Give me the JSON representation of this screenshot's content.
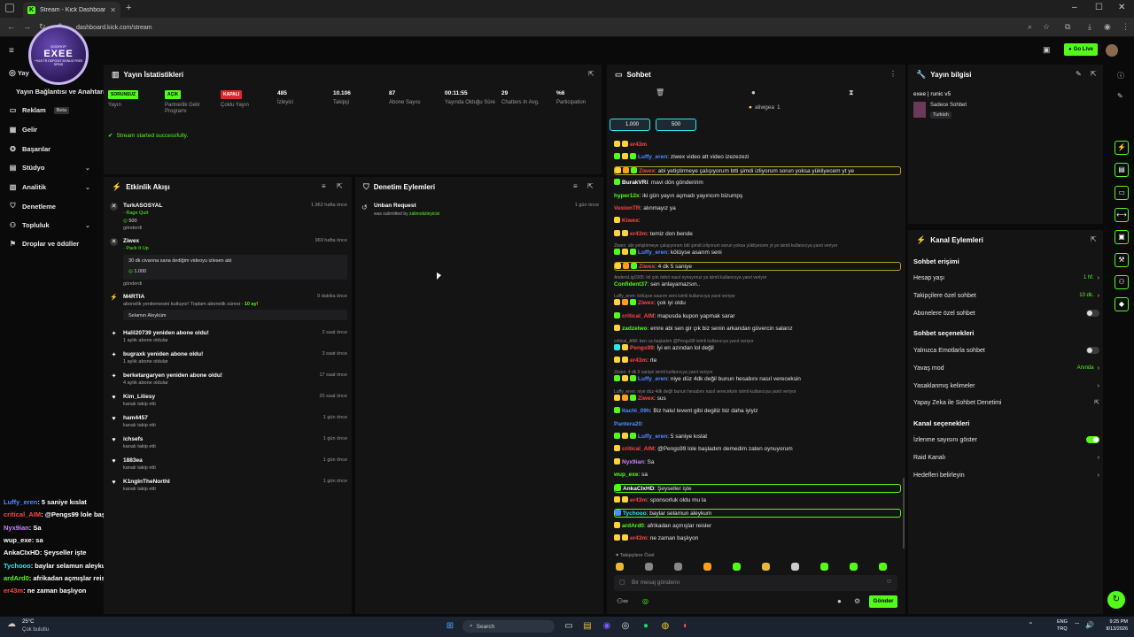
{
  "browser": {
    "tab_title": "Stream - Kick Dashboard",
    "url": "dashboard.kick.com/stream"
  },
  "header": {
    "go_live": "Go Live"
  },
  "overlay": {
    "brand": "GODROP",
    "name": "EXEE",
    "tagline": "+%15 TR DEPOSIT BONUS FREE SPINS"
  },
  "nav": {
    "items": [
      {
        "label": "Yayın Bağlantısı ve Anahtarı"
      },
      {
        "label": "Reklam",
        "badge": "Beta"
      },
      {
        "label": "Gelir"
      },
      {
        "label": "Başarılar"
      },
      {
        "label": "Stüdyo"
      },
      {
        "label": "Analitik"
      },
      {
        "label": "Denetleme"
      },
      {
        "label": "Topluluk"
      },
      {
        "label": "Droplar ve ödüller"
      }
    ],
    "partial": "Yay"
  },
  "stream_overlay_chat": [
    {
      "user": "Luffy_eren",
      "text": ": 5 saniye kıslat",
      "color": "#4f8cff"
    },
    {
      "user": "critical_AIM",
      "text": ": @Pengs99 lole başladım demedim zaten oynuyorum",
      "color": "#ff4545"
    },
    {
      "user": "Nyx9ian",
      "text": ": Sa",
      "color": "#c882ff"
    },
    {
      "user": "wup_exe",
      "text": ": sa",
      "color": "#fff"
    },
    {
      "user": "AnkaCIxHD",
      "text": ": Şeyseller işte",
      "color": "#fff"
    },
    {
      "user": "Tychooo",
      "text": ": baylar selamun aleykum",
      "color": "#2ee6e6"
    },
    {
      "user": "ardArd0",
      "text": ": afrikadan açmışlar reisler",
      "color": "#53fc18"
    },
    {
      "user": "er43m",
      "text": ": ne zaman başlıyon",
      "color": "#ff4545"
    }
  ],
  "stats": {
    "title": "Yayın İstatistikleri",
    "items": [
      {
        "value": "SORUNSUZ",
        "label": "Yayın",
        "chip": "#53fc18"
      },
      {
        "value": "AÇIK",
        "label": "Partnerlik Gelir Programı",
        "chip": "#53fc18"
      },
      {
        "value": "KAPALI",
        "label": "Çoklu Yayın",
        "chip": "#e0262b"
      },
      {
        "value": "485",
        "label": "İzleyici"
      },
      {
        "value": "10.106",
        "label": "Takipçi"
      },
      {
        "value": "87",
        "label": "Abone Sayısı"
      },
      {
        "value": "00:11:55",
        "label": "Yayında Olduğu Süre"
      },
      {
        "value": "29",
        "label": "Chatters In Avg."
      },
      {
        "value": "%6",
        "label": "Participation"
      }
    ],
    "success": "Stream started successfully."
  },
  "activity": {
    "title": "Etkinlik Akışı",
    "items": [
      {
        "name": "TurkASOSYAL",
        "sub": "Rage Quit",
        "extra": "500",
        "extra2": "gönderdi",
        "time": "1.962 hafta önce"
      },
      {
        "name": "Ziwex",
        "sub": "Pack It Up",
        "message": "30 dk civarına sana dediğim videoyu izlesen abi",
        "extra": "1.000",
        "extra2": "gönderdi",
        "time": "969 hafta önce"
      },
      {
        "name": "M4RTIA",
        "sub": "abonelik yenilemesini kutluyor! Toplam abonelik süresi - ",
        "sub_bold": "10 ay!",
        "message": "Selamın Aleyküm",
        "time": "9 dakika önce"
      },
      {
        "name": "Halil20739 yeniden abone oldu!",
        "sub": "1 aylık abone oldular",
        "time": "2 saat önce"
      },
      {
        "name": "bugraxk yeniden abone oldu!",
        "sub": "1 aylık abone oldular",
        "time": "3 saat önce"
      },
      {
        "name": "berketargaryen yeniden abone oldu!",
        "sub": "4 aylık abone oldular",
        "time": "17 saat önce"
      },
      {
        "name": "Kim_Liliesy",
        "sub": "kanalı takip etti",
        "time": "20 saat önce"
      },
      {
        "name": "ham4457",
        "sub": "kanalı takip etti",
        "time": "1 gün önce"
      },
      {
        "name": "ichsefs",
        "sub": "kanalı takip etti",
        "time": "1 gün önce"
      },
      {
        "name": "1883ea",
        "sub": "kanalı takip etti",
        "time": "1 gün önce"
      },
      {
        "name": "K1ngInTheNorthI",
        "sub": "kanalı takip etti",
        "time": "1 gün önce"
      }
    ]
  },
  "moderation": {
    "title": "Denetim Eylemleri",
    "items": [
      {
        "name": "Unban Request",
        "sub": "was submitted by ",
        "sub_user": "zalimotizleyicisi",
        "time": "1 gün önce"
      }
    ]
  },
  "chat": {
    "title": "Sohbet",
    "pinned_user": "aliwgea",
    "pinned_count": "1",
    "goal1": "1.000",
    "goal2": "500",
    "messages": [
      {
        "user": "er43m",
        "text": "",
        "color": "#ff4545",
        "badges": [
          "#ffd23a",
          "#ffd23a"
        ]
      },
      {
        "user": "Luffy_eren",
        "text": ": ziwex video att video izezezezi",
        "color": "#4f8cff",
        "badges": [
          "#53fc18",
          "#ffd23a",
          "#53fc18"
        ]
      },
      {
        "user": "Ziwex",
        "text": ": abi yetiştirmeye çalışıyorum btti şimdi izliyorum sorun yoksa yükliyecem yt ye",
        "color": "#ff4545",
        "badges": [
          "#ffd23a",
          "#ff9f1a",
          "#53fc18"
        ],
        "hl": true
      },
      {
        "user": "BurakVRi",
        "text": ": mavi dön gönderirim",
        "color": "#fff",
        "badges": [
          "#53fc18"
        ]
      },
      {
        "user": "hyper12x",
        "text": ": iki gün yayın açmadı yayıncım bizumpş",
        "color": "#53fc18",
        "badges": []
      },
      {
        "user": "VexionTR",
        "text": ": alınmayız ya",
        "color": "#ff4545",
        "badges": []
      },
      {
        "user": "Kiwex",
        "text": ":",
        "color": "#ff4545",
        "badges": [
          "#ffd23a"
        ]
      },
      {
        "user": "er43m",
        "text": ": temiz don bende",
        "color": "#ff4545",
        "badges": [
          "#ffd23a",
          "#ffd23a"
        ]
      },
      {
        "small": "Ziwex: abi yetiştirmeye çalışıyorum btti şimdi izliyorum sorun yoksa yükliyecem yt ye isimli kullanıcıya yanıt veriyor"
      },
      {
        "user": "Luffy_eren",
        "text": ": kötüyse asarım seni",
        "color": "#4f8cff",
        "badges": [
          "#53fc18",
          "#ffd23a",
          "#53fc18"
        ]
      },
      {
        "user": "Ziwex",
        "text": ": 4 dk 5 saniye",
        "color": "#ff4545",
        "badges": [
          "#ffd23a",
          "#ff9f1a",
          "#53fc18"
        ],
        "hl": true
      },
      {
        "small": "AndersLig1905: lol çok ödnö nasıl oynuyoruz ya isimli kullanıcıya yanıt veriyor"
      },
      {
        "user": "Confident37",
        "text": ": sen anlayamazsın..",
        "color": "#53fc18",
        "badges": []
      },
      {
        "small": "Luffy_eren: kötüyse asarım seni isimli kullanıcıya yanıt veriyor"
      },
      {
        "user": "Ziwex",
        "text": ": çok iyi oldu",
        "color": "#ff4545",
        "badges": [
          "#ffd23a",
          "#ff9f1a",
          "#53fc18"
        ]
      },
      {
        "user": "critical_AIM",
        "text": ": mapusda kupon yapmak sarar",
        "color": "#ff4545",
        "badges": [
          "#53fc18"
        ]
      },
      {
        "user": "zadzelwo",
        "text": ": emre abi sen gir çık biz senin arkandan güvercin salarız",
        "color": "#53fc18",
        "badges": [
          "#ffd23a"
        ]
      },
      {
        "small": "critical_AIM: ben ca başladım @Pengs99 isimli kullanıcıya yanıt veriyor"
      },
      {
        "user": "Pengs99",
        "text": ": İyi en azından lol değil",
        "color": "#ff4545",
        "badges": [
          "#2ee6e6",
          "#ffd23a"
        ]
      },
      {
        "user": "er43m",
        "text": ": rte",
        "color": "#ff4545",
        "badges": [
          "#ffd23a",
          "#ffd23a"
        ]
      },
      {
        "small": "Ziwex: 4 dk 5 saniye isimli kullanıcıya yanıt veriyor"
      },
      {
        "user": "Luffy_eren",
        "text": ": niye düz 4dk değil bunun hesabını nasıl vereceksin",
        "color": "#4f8cff",
        "badges": [
          "#53fc18",
          "#ffd23a",
          "#53fc18"
        ]
      },
      {
        "small": "Luffy_eren: niye düz 4dk değil bunun hesabını nasıl vereceksin isimli kullanıcıya yanıt veriyor"
      },
      {
        "user": "Ziwex",
        "text": ": sus",
        "color": "#ff4545",
        "badges": [
          "#ffd23a",
          "#ff9f1a",
          "#53fc18"
        ]
      },
      {
        "user": "Itachi_09h",
        "text": ": Biz halul levent gibi degiliz biz daha iyiyiz",
        "color": "#4f8cff",
        "badges": [
          "#53fc18"
        ]
      },
      {
        "user": "Pantera20",
        "text": ":",
        "color": "#4f8cff",
        "badges": []
      },
      {
        "user": "Luffy_eren",
        "text": ": 5 saniye kıslat",
        "color": "#4f8cff",
        "badges": [
          "#53fc18",
          "#ffd23a",
          "#53fc18"
        ]
      },
      {
        "user": "critical_AIM",
        "text": ": @Pengs99 lole başladım demedim zaten oynuyorum",
        "color": "#ff4545",
        "badges": [
          "#ffd23a"
        ]
      },
      {
        "user": "Nyx9ian",
        "text": ": Sa",
        "color": "#c882ff",
        "badges": [
          "#ffd23a"
        ]
      },
      {
        "user": "wup_exe",
        "text": ": sa",
        "color": "#53fc18",
        "badges": []
      },
      {
        "user": "AnkaCIxHD",
        "text": ": Şeyseller işte",
        "color": "#fff",
        "badges": [
          "#53fc18"
        ],
        "hlg": true
      },
      {
        "user": "er43m",
        "text": ": sponsorluk oldu mu la",
        "color": "#ff4545",
        "badges": [
          "#ffd23a",
          "#ffd23a"
        ]
      },
      {
        "user": "Tychooo",
        "text": ": baylar selamun aleykum",
        "color": "#2ee6e6",
        "badges": [
          "#4f8cff"
        ],
        "hlg": true
      },
      {
        "user": "ardArd0",
        "text": ": afrikadan açmışlar reisler",
        "color": "#53fc18",
        "badges": [
          "#ffd23a"
        ]
      },
      {
        "user": "er43m",
        "text": ": ne zaman başlıyon",
        "color": "#ff4545",
        "badges": [
          "#ffd23a",
          "#ffd23a"
        ]
      }
    ],
    "mode_label": "Takipçilere Özel",
    "input_placeholder": "Bir mesaj gönderin",
    "send": "Gönder"
  },
  "stream_info": {
    "title": "Yayın bilgisi",
    "stream_title": "exee | runic v5",
    "chat_mode": "Sadece Sohbet",
    "language": "Turkish"
  },
  "channel_actions": {
    "title": "Kanal Eylemleri",
    "chat_access": "Sohbet erişimi",
    "rows1": [
      {
        "label": "Hesap yaşı",
        "value": "1 hf."
      },
      {
        "label": "Takipçilere özel sohbet",
        "value": "10 dk."
      },
      {
        "label": "Abonelere özel sohbet",
        "toggle": false
      }
    ],
    "chat_options": "Sohbet seçenekleri",
    "rows2": [
      {
        "label": "Yalnızca Emotlarla sohbet",
        "toggle": false
      },
      {
        "label": "Yavaş mod",
        "value": "Anında"
      },
      {
        "label": "Yasaklanmış kelimeler",
        "value": ""
      },
      {
        "label": "Yapay Zeka ile Sohbet Denetimi",
        "value": ""
      }
    ],
    "channel_options": "Kanal seçenekleri",
    "rows3": [
      {
        "label": "İzlenme sayısını göster",
        "toggle": true
      },
      {
        "label": "Raid Kanalı",
        "value": ""
      },
      {
        "label": "Hedefleri belirleyin",
        "value": ""
      }
    ]
  },
  "taskbar": {
    "temp": "25°C",
    "weather": "Çok bulutlu",
    "search": "Search",
    "lang1": "ENG",
    "lang2": "TRQ",
    "time": "9:25 PM",
    "date": "8/13/2026"
  }
}
